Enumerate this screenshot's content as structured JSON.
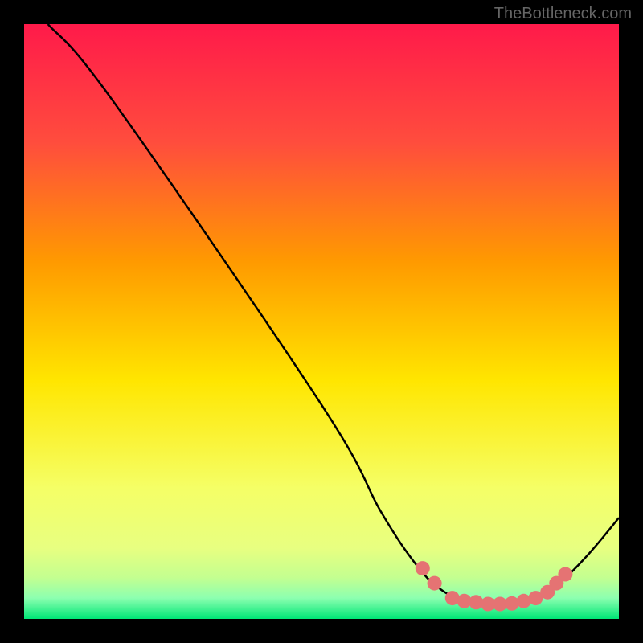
{
  "watermark": "TheBottleneck.com",
  "chart_data": {
    "type": "line",
    "title": "",
    "xlabel": "",
    "ylabel": "",
    "xlim": [
      0,
      100
    ],
    "ylim": [
      0,
      100
    ],
    "background_gradient": {
      "top": "#ff1a4a",
      "mid_upper": "#ff9a00",
      "mid": "#ffe600",
      "mid_lower": "#f5ff66",
      "low": "#d4ff88",
      "bottom": "#00e676"
    },
    "curve": [
      {
        "x": 4,
        "y": 100
      },
      {
        "x": 15,
        "y": 87
      },
      {
        "x": 50,
        "y": 36
      },
      {
        "x": 60,
        "y": 18
      },
      {
        "x": 66,
        "y": 9
      },
      {
        "x": 70,
        "y": 5
      },
      {
        "x": 74,
        "y": 3
      },
      {
        "x": 78,
        "y": 2.5
      },
      {
        "x": 82,
        "y": 2.5
      },
      {
        "x": 86,
        "y": 3.5
      },
      {
        "x": 90,
        "y": 6
      },
      {
        "x": 95,
        "y": 11
      },
      {
        "x": 100,
        "y": 17
      }
    ],
    "markers": [
      {
        "x": 67,
        "y": 8.5
      },
      {
        "x": 69,
        "y": 6
      },
      {
        "x": 72,
        "y": 3.5
      },
      {
        "x": 74,
        "y": 3
      },
      {
        "x": 76,
        "y": 2.8
      },
      {
        "x": 78,
        "y": 2.5
      },
      {
        "x": 80,
        "y": 2.5
      },
      {
        "x": 82,
        "y": 2.6
      },
      {
        "x": 84,
        "y": 3
      },
      {
        "x": 86,
        "y": 3.5
      },
      {
        "x": 88,
        "y": 4.5
      },
      {
        "x": 89.5,
        "y": 6
      },
      {
        "x": 91,
        "y": 7.5
      }
    ],
    "marker_color": "#e57373"
  }
}
